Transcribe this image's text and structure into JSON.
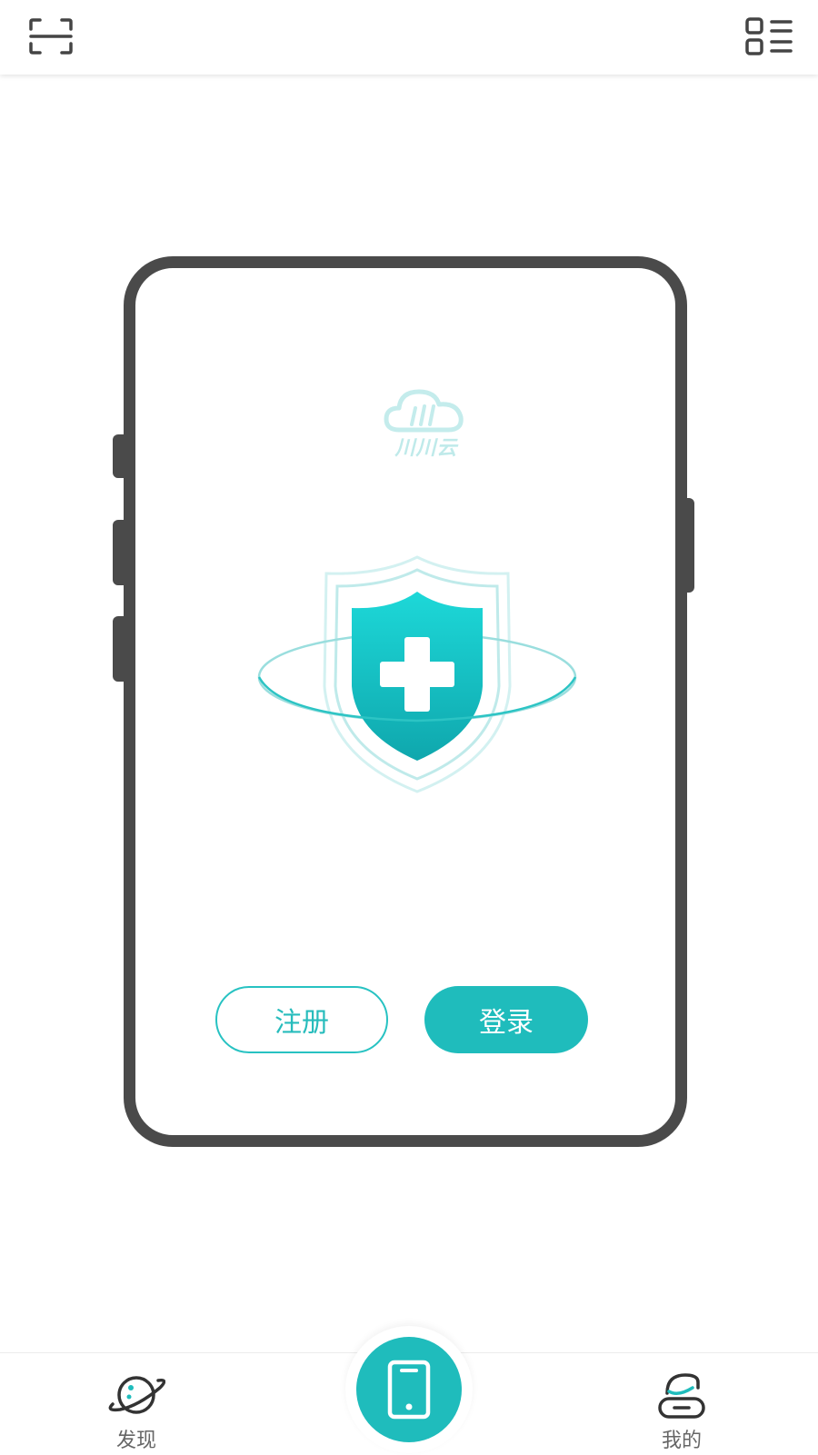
{
  "header": {
    "scan_icon": "scan-icon",
    "menu_icon": "grid-list-icon"
  },
  "device_card": {
    "brand_text": "川川云",
    "illustration": "shield-plus-icon",
    "register_label": "注册",
    "login_label": "登录"
  },
  "bottom_nav": {
    "items": [
      {
        "label": "发现",
        "icon": "planet-icon"
      },
      {
        "label": "",
        "icon": "phone-icon"
      },
      {
        "label": "我的",
        "icon": "profile-icon"
      }
    ]
  },
  "colors": {
    "accent": "#1fbcbc",
    "frame": "#4a4a4a",
    "text_muted": "#666666"
  }
}
